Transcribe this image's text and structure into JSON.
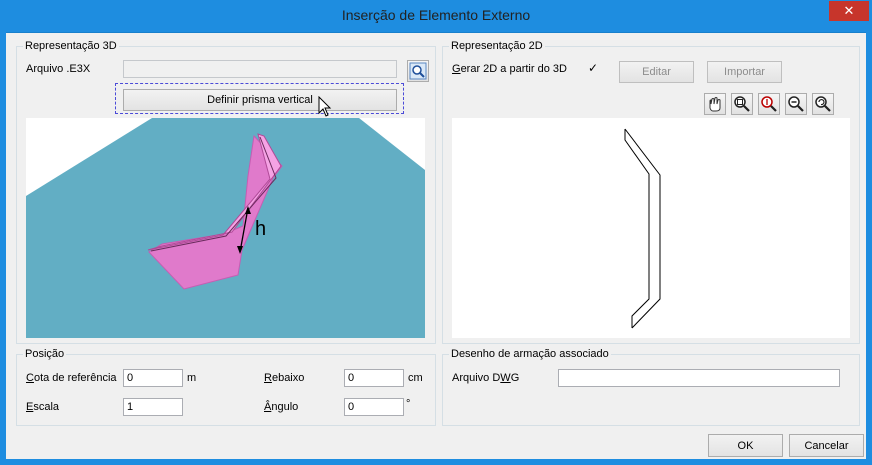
{
  "window": {
    "title": "Inserção de Elemento Externo",
    "close_glyph": "✕"
  },
  "rep3d": {
    "legend": "Representação 3D",
    "file_label": "Arquivo .E3X",
    "file_value": "",
    "prism_button": "Definir prisma vertical",
    "height_label": "h"
  },
  "rep2d": {
    "legend": "Representação 2D",
    "generate_label": "Gerar 2D a partir do 3D",
    "generate_checked": true,
    "check_glyph": "✓",
    "edit_button": "Editar",
    "import_button": "Importar"
  },
  "position": {
    "legend": "Posição",
    "ref_label": "Cota de referência",
    "ref_value": "0",
    "ref_unit": "m",
    "scale_label": "Escala",
    "scale_value": "1",
    "rebaixo_label": "Rebaixo",
    "rebaixo_value": "0",
    "rebaixo_unit": "cm",
    "angle_label": "Ângulo",
    "angle_value": "0",
    "angle_unit": "°"
  },
  "dwg": {
    "legend": "Desenho de armação associado",
    "file_label": "Arquivo DWG",
    "file_value": ""
  },
  "footer": {
    "ok": "OK",
    "cancel": "Cancelar"
  },
  "colors": {
    "title_bar": "#1e8de0",
    "floor": "#62aec4",
    "prism": "#e67fcf",
    "close": "#c7352b"
  }
}
